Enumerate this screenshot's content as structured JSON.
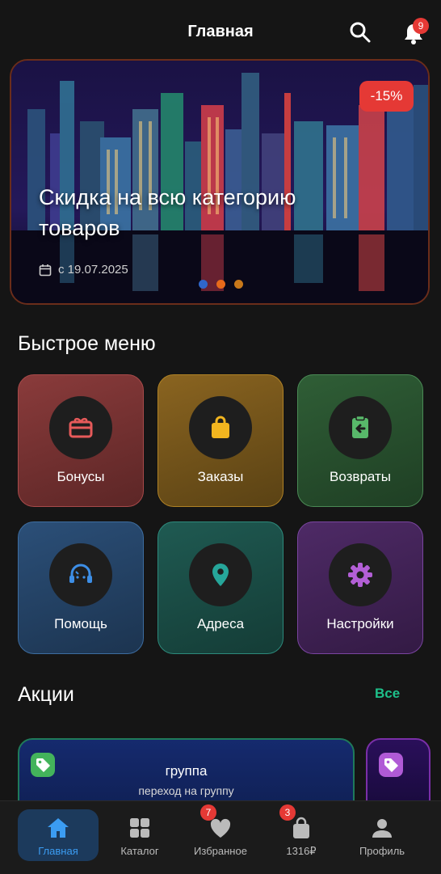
{
  "header": {
    "title": "Главная",
    "notifications_count": "9"
  },
  "banner": {
    "discount": "-15%",
    "headline": "Скидка на всю категорию товаров",
    "date": "с 19.07.2025",
    "dots": [
      "#2f66c9",
      "#e86a1a",
      "#c8781a"
    ]
  },
  "quick_menu": {
    "title": "Быстрое меню",
    "items": [
      {
        "label": "Бонусы",
        "icon": "gift-card-icon",
        "color": "#e65a5a"
      },
      {
        "label": "Заказы",
        "icon": "shopping-bag-icon",
        "color": "#f2b51f"
      },
      {
        "label": "Возвраты",
        "icon": "return-icon",
        "color": "#58b86a"
      },
      {
        "label": "Помощь",
        "icon": "headset-icon",
        "color": "#3d8ee6"
      },
      {
        "label": "Адреса",
        "icon": "location-pin-icon",
        "color": "#26a69a"
      },
      {
        "label": "Настройки",
        "icon": "gear-icon",
        "color": "#b35fd6"
      }
    ]
  },
  "promos": {
    "title": "Акции",
    "all_label": "Все",
    "items": [
      {
        "title": "группа",
        "subtitle": "переход на группу",
        "tag_color": "#43b35b"
      },
      {
        "title": "",
        "subtitle": "",
        "tag_color": "#b05ad6"
      }
    ]
  },
  "bottom_nav": {
    "items": [
      {
        "label": "Главная",
        "icon": "home-icon",
        "active": true
      },
      {
        "label": "Каталог",
        "icon": "grid-icon"
      },
      {
        "label": "Избранное",
        "icon": "heart-icon",
        "badge": "7"
      },
      {
        "label": "1316₽",
        "icon": "shopping-bag-icon",
        "badge": "3"
      },
      {
        "label": "Профиль",
        "icon": "profile-icon"
      }
    ]
  }
}
